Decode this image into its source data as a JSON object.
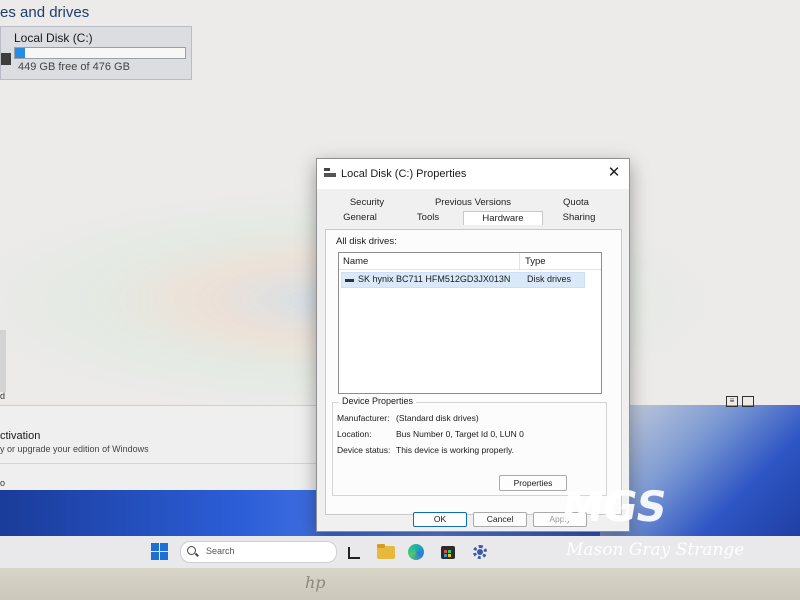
{
  "explorer": {
    "section_title": "es and drives",
    "drive": {
      "name": "Local Disk (C:)",
      "free_text": "449 GB free of 476 GB",
      "used_fraction": 0.06
    },
    "left_fragment": "d"
  },
  "settings_bg": {
    "activation_title": "ctivation",
    "activation_sub": "y or upgrade your edition of Windows",
    "fragment": "o"
  },
  "dialog": {
    "title": "Local Disk (C:) Properties",
    "close_glyph": "✕",
    "tabs_top": [
      "Security",
      "Previous Versions",
      "Quota"
    ],
    "tabs_bottom": [
      "General",
      "Tools",
      "Hardware",
      "Sharing"
    ],
    "active_tab": "Hardware",
    "all_drives_label": "All disk drives:",
    "columns": [
      "Name",
      "Type"
    ],
    "rows": [
      {
        "name": "SK hynix BC711 HFM512GD3JX013N",
        "type": "Disk drives"
      }
    ],
    "device_properties": {
      "legend": "Device Properties",
      "manufacturer_label": "Manufacturer:",
      "manufacturer": "(Standard disk drives)",
      "location_label": "Location:",
      "location": "Bus Number 0, Target Id 0, LUN 0",
      "status_label": "Device status:",
      "status": "This device is working properly.",
      "properties_button": "Properties"
    },
    "buttons": {
      "ok": "OK",
      "cancel": "Cancel",
      "apply": "Apply"
    }
  },
  "taskbar": {
    "search_placeholder": "Search"
  },
  "bezel": {
    "logo": "hp"
  },
  "watermark": {
    "big": "MGS",
    "small": "Mason Gray Strange"
  },
  "colors": {
    "accent": "#0f6cbd",
    "drive_bar": "#2a8be0",
    "selection": "#d9e9f9",
    "wallpaper": "#2c5ed8"
  },
  "icons": {
    "drive": "drive-icon",
    "close": "close-icon",
    "windows": "windows-logo-icon",
    "search": "search-icon",
    "explorer": "folder-icon",
    "edge": "edge-icon",
    "store": "store-icon",
    "settings": "gear-icon"
  }
}
